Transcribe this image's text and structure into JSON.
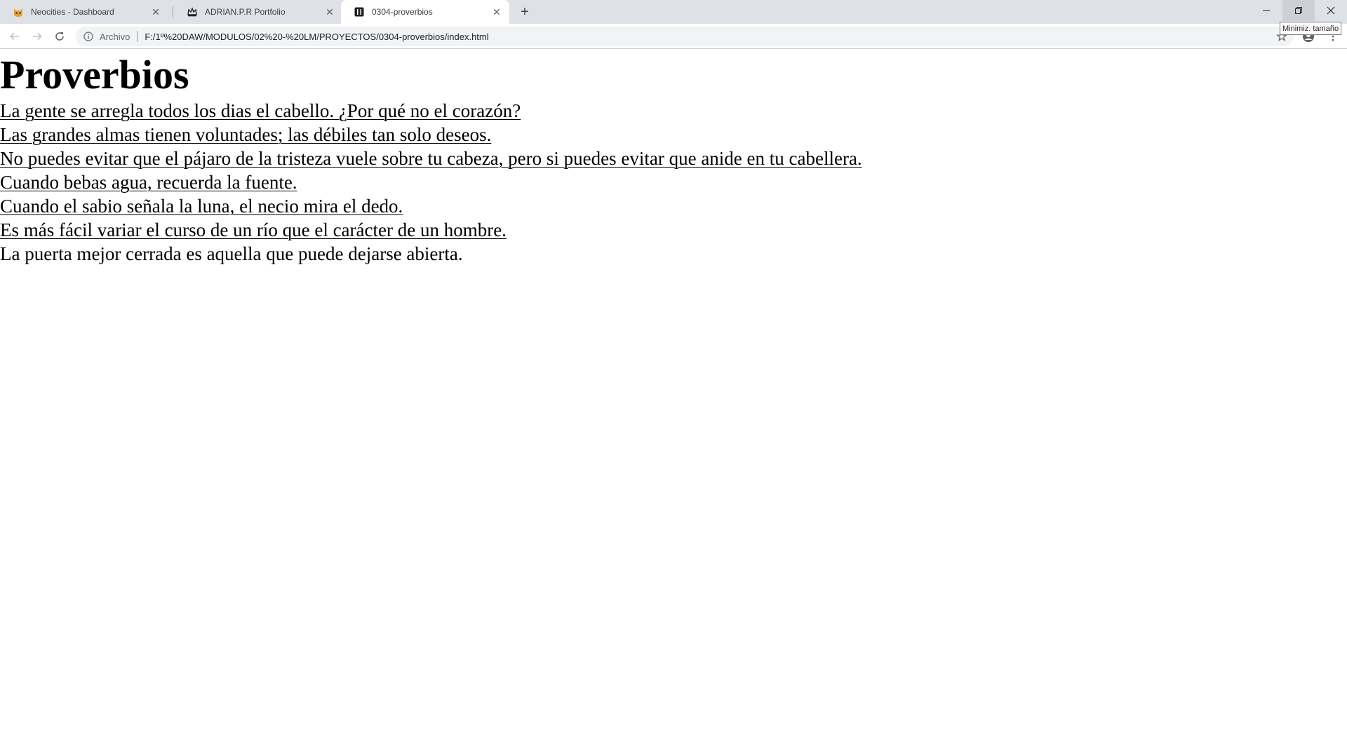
{
  "browser": {
    "tabs": [
      {
        "title": "Neocities - Dashboard",
        "icon": "cat-icon",
        "active": false
      },
      {
        "title": "ADRIAN.P.R Portfolio",
        "icon": "crown-icon",
        "active": false
      },
      {
        "title": "0304-proverbios",
        "icon": "bracket-icon",
        "active": true
      }
    ],
    "new_tab_label": "+",
    "tooltip": "Minimiz. tamaño",
    "address": {
      "scheme_label": "Archivo",
      "url": "F:/1º%20DAW/MODULOS/02%20-%20LM/PROYECTOS/0304-proverbios/index.html"
    }
  },
  "page": {
    "title": "Proverbios",
    "proverbs": [
      {
        "text": "La gente se arregla todos los dias el cabello. ¿Por qué no el corazón?",
        "link": true
      },
      {
        "text": "Las grandes almas tienen voluntades; las débiles tan solo deseos.",
        "link": true
      },
      {
        "text": "No puedes evitar que el pájaro de la tristeza vuele sobre tu cabeza, pero si puedes evitar que anide en tu cabellera.",
        "link": true
      },
      {
        "text": "Cuando bebas agua, recuerda la fuente.",
        "link": true
      },
      {
        "text": "Cuando el sabio señala la luna, el necio mira el dedo.",
        "link": true
      },
      {
        "text": "Es más fácil variar el curso de un río que el carácter de un hombre.",
        "link": true
      },
      {
        "text": "La puerta mejor cerrada es aquella que puede dejarse abierta.",
        "link": false
      }
    ]
  }
}
